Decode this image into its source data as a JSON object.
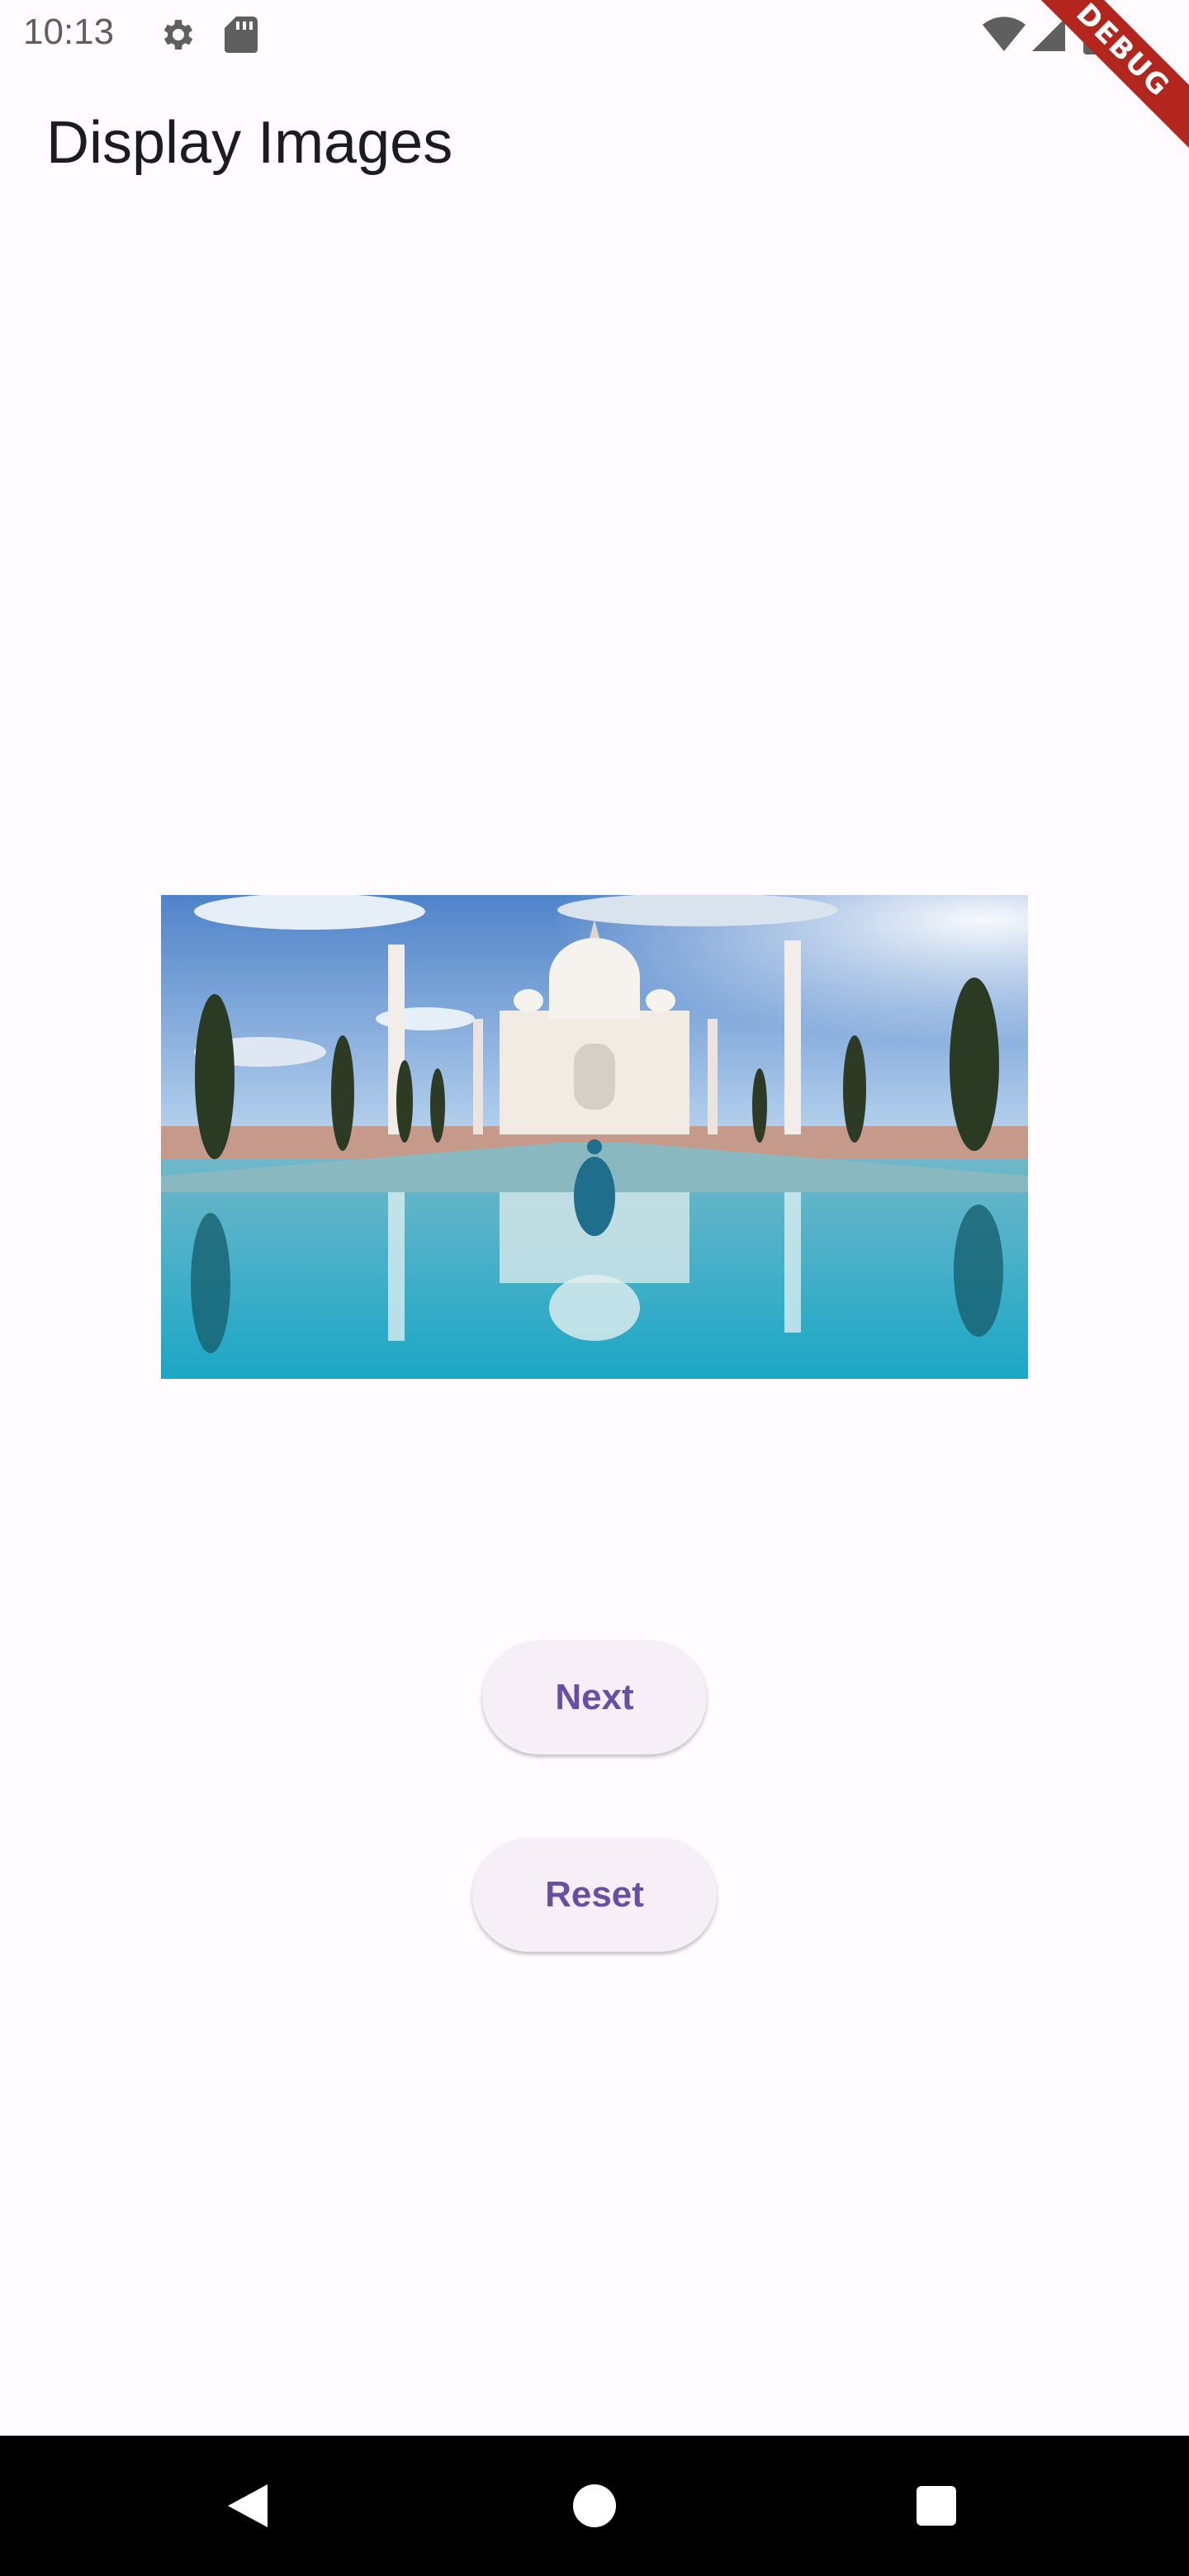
{
  "status_bar": {
    "time": "10:13",
    "left_icons": [
      "gear-icon",
      "sd-card-icon"
    ],
    "right_icons": [
      "wifi-icon",
      "signal-icon",
      "battery-icon"
    ]
  },
  "debug_banner": {
    "label": "DEBUG",
    "color": "#b3261e"
  },
  "app_bar": {
    "title": "Display Images"
  },
  "content": {
    "image_icon": "taj-mahal-photo"
  },
  "buttons": {
    "next_label": "Next",
    "reset_label": "Reset"
  },
  "nav_bar": {
    "icons": [
      "back-icon",
      "home-icon",
      "recents-icon"
    ]
  },
  "colors": {
    "background": "#fffbfe",
    "accent": "#6750a4",
    "button_surface": "#f6eff8",
    "title_text": "#1c1b1f"
  }
}
